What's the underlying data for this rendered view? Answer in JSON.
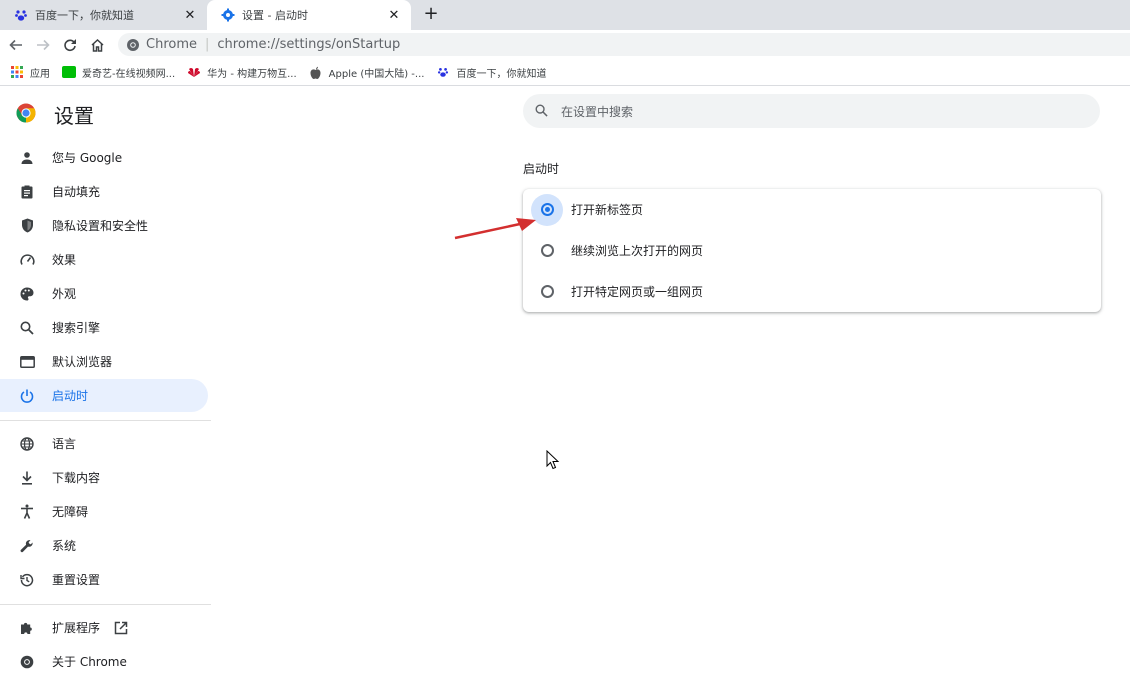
{
  "tabs": [
    {
      "title": "百度一下，你就知道",
      "close": "✕"
    },
    {
      "title": "设置 - 启动时",
      "close": "✕"
    }
  ],
  "new_tab_label": "+",
  "omnibox": {
    "chip": "Chrome",
    "separator": "|",
    "url": "chrome://settings/onStartup"
  },
  "bookmarks": [
    {
      "label": "应用"
    },
    {
      "label": "爱奇艺-在线视频网..."
    },
    {
      "label": "华为 - 构建万物互..."
    },
    {
      "label": "Apple (中国大陆) -..."
    },
    {
      "label": "百度一下，你就知道"
    }
  ],
  "sidebar": {
    "title": "设置",
    "items": [
      {
        "label": "您与 Google",
        "icon": "person-icon"
      },
      {
        "label": "自动填充",
        "icon": "clipboard-icon"
      },
      {
        "label": "隐私设置和安全性",
        "icon": "shield-icon"
      },
      {
        "label": "效果",
        "icon": "speedometer-icon"
      },
      {
        "label": "外观",
        "icon": "palette-icon"
      },
      {
        "label": "搜索引擎",
        "icon": "search-icon"
      },
      {
        "label": "默认浏览器",
        "icon": "browser-icon"
      },
      {
        "label": "启动时",
        "icon": "power-icon"
      },
      {
        "label": "语言",
        "icon": "globe-icon"
      },
      {
        "label": "下载内容",
        "icon": "download-icon"
      },
      {
        "label": "无障碍",
        "icon": "accessibility-icon"
      },
      {
        "label": "系统",
        "icon": "wrench-icon"
      },
      {
        "label": "重置设置",
        "icon": "restore-icon"
      },
      {
        "label": "扩展程序",
        "icon": "puzzle-icon"
      },
      {
        "label": "关于 Chrome",
        "icon": "chrome-icon"
      }
    ]
  },
  "search": {
    "placeholder": "在设置中搜索"
  },
  "section": {
    "title": "启动时"
  },
  "options": [
    {
      "label": "打开新标签页",
      "checked": true
    },
    {
      "label": "继续浏览上次打开的网页",
      "checked": false
    },
    {
      "label": "打开特定网页或一组网页",
      "checked": false
    }
  ],
  "colors": {
    "accent": "#1a73e8",
    "selected_bg": "#e8f0fe",
    "annotation_arrow": "#d32f2f"
  }
}
